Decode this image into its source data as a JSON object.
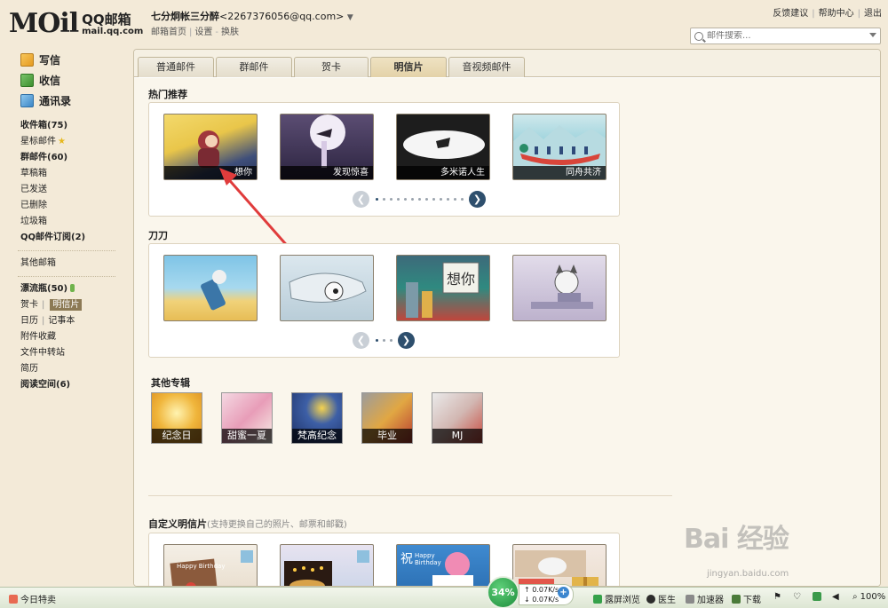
{
  "header": {
    "logo_mail": "MOil",
    "logo_qq": "QQ邮箱",
    "logo_url": "mail.qq.com",
    "nickname": "七分炯帐三分醉",
    "email": "<2267376056@qq.com>",
    "links": [
      "邮箱首页",
      "设置",
      "换肤"
    ],
    "top_links": [
      "反馈建议",
      "帮助中心",
      "退出"
    ],
    "search_placeholder": "邮件搜索..."
  },
  "sidebar": {
    "actions": [
      {
        "label": "写信",
        "icon": "compose-icon"
      },
      {
        "label": "收信",
        "icon": "inbox-icon"
      },
      {
        "label": "通讯录",
        "icon": "contacts-icon"
      }
    ],
    "folders": [
      {
        "label": "收件箱(75)",
        "bold": true
      },
      {
        "label": "星标邮件",
        "bold": false
      },
      {
        "label": "群邮件(60)",
        "bold": true
      },
      {
        "label": "草稿箱",
        "bold": false
      },
      {
        "label": "已发送",
        "bold": false
      },
      {
        "label": "已删除",
        "bold": false
      },
      {
        "label": "垃圾箱",
        "bold": false
      },
      {
        "label": "QQ邮件订阅(2)",
        "bold": true
      }
    ],
    "other_mailbox": "其他邮箱",
    "apps": {
      "drift_bottle": "漂流瓶(50)",
      "greeting_card": "贺卡",
      "postcard": "明信片",
      "calendar": "日历",
      "notepad": "记事本",
      "attachments": "附件收藏",
      "file_transfer": "文件中转站",
      "resume": "简历",
      "reading": "阅读空间(6)"
    }
  },
  "tabs": [
    {
      "label": "普通邮件",
      "active": false
    },
    {
      "label": "群邮件",
      "active": false
    },
    {
      "label": "贺卡",
      "active": false
    },
    {
      "label": "明信片",
      "active": true
    },
    {
      "label": "音视频邮件",
      "active": false
    }
  ],
  "hot": {
    "title": "热门推荐",
    "cards": [
      "想你",
      "发现惊喜",
      "多米诺人生",
      "同舟共济"
    ],
    "dots": 13
  },
  "daodao": {
    "title": "刀刀",
    "dots": 3
  },
  "albums": {
    "title": "其他专辑",
    "items": [
      "纪念日",
      "甜蜜一夏",
      "梵高纪念",
      "毕业",
      "MJ"
    ]
  },
  "custom": {
    "title": "自定义明信片",
    "note": "(支持更换自己的照片、邮票和邮戳)"
  },
  "statusbar": {
    "left": "今日特卖",
    "percent": "34%",
    "up_speed": "0.07K/s",
    "down_speed": "0.07K/s",
    "items": [
      "露屏浏览",
      "医生",
      "加速器",
      "下载"
    ],
    "zoom": "100%"
  },
  "watermark": {
    "main": "Bai 经验",
    "sub": "jingyan.baidu.com"
  }
}
